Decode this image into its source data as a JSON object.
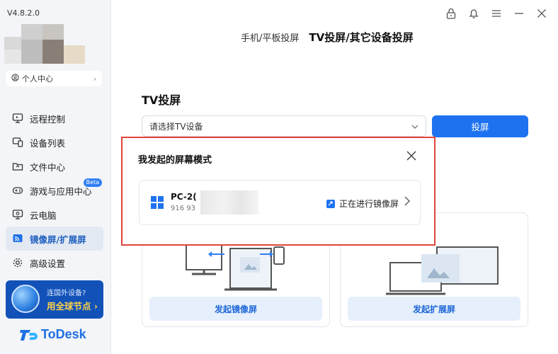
{
  "app": {
    "version": "V4.8.2.0",
    "logo_text": "ToDesk"
  },
  "sidebar": {
    "profile_label": "个人中心",
    "items": [
      {
        "label": "远程控制",
        "icon": "remote-control-icon"
      },
      {
        "label": "设备列表",
        "icon": "device-list-icon"
      },
      {
        "label": "文件中心",
        "icon": "folder-icon"
      },
      {
        "label": "游戏与应用中心",
        "icon": "gamepad-icon",
        "badge": "Beta"
      },
      {
        "label": "云电脑",
        "icon": "cloud-pc-icon"
      },
      {
        "label": "镜像屏/扩展屏",
        "icon": "cast-icon",
        "active": true
      },
      {
        "label": "高级设置",
        "icon": "gear-icon"
      }
    ],
    "promo": {
      "line1": "连国外设备?",
      "line2": "用全球节点 ›"
    }
  },
  "header": {
    "tabs": [
      {
        "label": "手机/平板投屏",
        "active": false
      },
      {
        "label": "TV投屏/其它设备投屏",
        "active": true
      }
    ]
  },
  "main": {
    "section_title": "TV投屏",
    "select_placeholder": "请选择TV设备",
    "cast_button": "投屏",
    "cards": [
      {
        "button": "发起镜像屏"
      },
      {
        "button": "发起扩展屏"
      }
    ]
  },
  "popup": {
    "title": "我发起的屏幕模式",
    "device": {
      "name": "PC-2(",
      "id": "916 93",
      "status": "正在进行镜像屏"
    }
  },
  "colors": {
    "accent": "#1e72f0",
    "highlight_border": "#e0453b",
    "promo_bg": "#1252b8",
    "promo_text": "#ffd24a"
  }
}
